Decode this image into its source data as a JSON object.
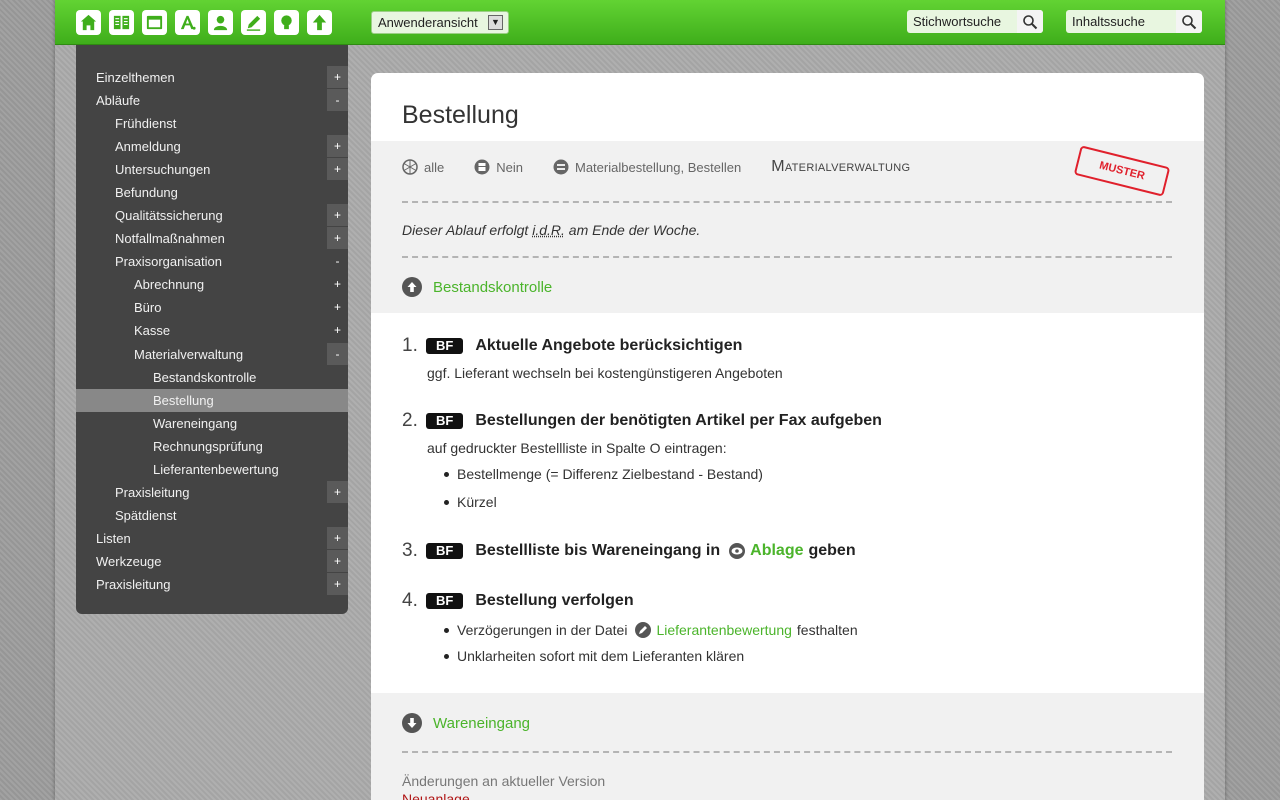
{
  "toolbar": {
    "icons": [
      "home-icon",
      "book-icon",
      "folder-icon",
      "font-icon",
      "user-icon",
      "pencil-icon",
      "lightbulb-icon",
      "arrow-up-icon"
    ],
    "view_select": "Anwenderansicht",
    "keyword_search": "Stichwortsuche",
    "content_search": "Inhaltssuche"
  },
  "sidebar": {
    "items": [
      {
        "label": "Einzelthemen",
        "toggle": "+"
      },
      {
        "label": "Abläufe",
        "toggle": "-"
      },
      {
        "label": "Frühdienst",
        "toggle": ""
      },
      {
        "label": "Anmeldung",
        "toggle": "+"
      },
      {
        "label": "Untersuchungen",
        "toggle": "+"
      },
      {
        "label": "Befundung",
        "toggle": ""
      },
      {
        "label": "Qualitätssicherung",
        "toggle": "+"
      },
      {
        "label": "Notfallmaßnahmen",
        "toggle": "+"
      },
      {
        "label": "Praxisorganisation",
        "toggle": "-"
      },
      {
        "label": "Abrechnung",
        "toggle": "+"
      },
      {
        "label": "Büro",
        "toggle": "+"
      },
      {
        "label": "Kasse",
        "toggle": "+"
      },
      {
        "label": "Materialverwaltung",
        "toggle": "-"
      },
      {
        "label": "Bestandskontrolle",
        "toggle": ""
      },
      {
        "label": "Bestellung",
        "toggle": ""
      },
      {
        "label": "Wareneingang",
        "toggle": ""
      },
      {
        "label": "Rechnungsprüfung",
        "toggle": ""
      },
      {
        "label": "Lieferantenbewertung",
        "toggle": ""
      },
      {
        "label": "Praxisleitung",
        "toggle": "+"
      },
      {
        "label": "Spätdienst",
        "toggle": ""
      },
      {
        "label": "Listen",
        "toggle": "+"
      },
      {
        "label": "Werkzeuge",
        "toggle": "+"
      },
      {
        "label": "Praxisleitung",
        "toggle": "+"
      }
    ]
  },
  "main": {
    "title": "Bestellung",
    "meta": {
      "scope": "alle",
      "print": "Nein",
      "tags": "Materialbestellung, Bestellen",
      "category": "Materialverwaltung",
      "stamp": "MUSTER"
    },
    "note_pre": "Dieser Ablauf erfolgt ",
    "note_abbr": "i.d.R.",
    "note_post": " am Ende der Woche.",
    "prev_link": "Bestandskontrolle",
    "steps": [
      {
        "num": "1.",
        "badge": "BF",
        "title": "Aktuelle Angebote berücksichtigen",
        "desc": "ggf. Lieferant wechseln bei kostengünstigeren Angeboten"
      },
      {
        "num": "2.",
        "badge": "BF",
        "title": "Bestellungen der benötigten Artikel per Fax aufgeben",
        "desc": "auf gedruckter Bestellliste in Spalte O eintragen:",
        "bullets": [
          "Bestellmenge (= Differenz Zielbestand - Bestand)",
          "Kürzel"
        ]
      },
      {
        "num": "3.",
        "badge": "BF",
        "title_pre": "Bestellliste bis Wareneingang in",
        "title_link": "Ablage",
        "title_post": "geben"
      },
      {
        "num": "4.",
        "badge": "BF",
        "title": "Bestellung verfolgen",
        "bullet1_pre": "Verzögerungen in der Datei",
        "bullet1_link": "Lieferantenbewertung",
        "bullet1_post": "festhalten",
        "bullet2": "Unklarheiten sofort mit dem Lieferanten klären"
      }
    ],
    "next_link": "Wareneingang",
    "changes_label": "Änderungen an aktueller Version",
    "new_label": "Neuanlage"
  },
  "colors": {
    "accent": "#4bb42b",
    "topbar": "#52c226",
    "sidebar": "#444444",
    "stamp": "#e0202c"
  }
}
